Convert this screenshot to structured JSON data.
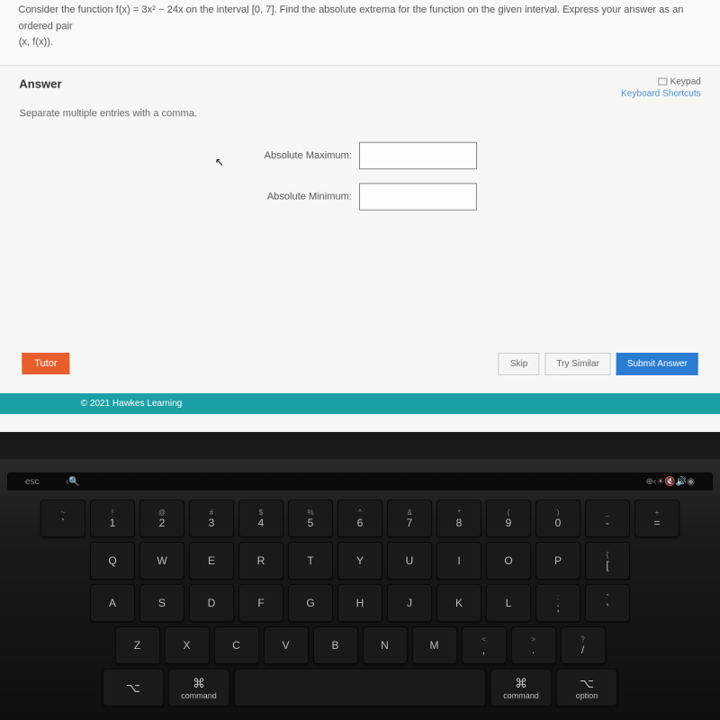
{
  "question": {
    "prompt_line1": "Consider the function f(x) = 3x² − 24x on the interval [0, 7]. Find the absolute extrema for the function on the given interval. Express your answer as an ordered pair",
    "prompt_line2": "(x, f(x))."
  },
  "answer_section": {
    "header": "Answer",
    "keypad_label": "Keypad",
    "shortcuts_label": "Keyboard Shortcuts",
    "instruction": "Separate multiple entries with a comma.",
    "max_label": "Absolute Maximum:",
    "min_label": "Absolute Minimum:",
    "max_value": "",
    "min_value": ""
  },
  "buttons": {
    "tutor": "Tutor",
    "skip": "Skip",
    "try_similar": "Try Similar",
    "submit": "Submit Answer"
  },
  "footer": {
    "copyright": "© 2021 Hawkes Learning"
  },
  "keyboard": {
    "esc": "esc",
    "touch_bar_search": "🔍",
    "row1": [
      {
        "top": "!",
        "bottom": "1"
      },
      {
        "top": "@",
        "bottom": "2"
      },
      {
        "top": "#",
        "bottom": "3"
      },
      {
        "top": "$",
        "bottom": "4"
      },
      {
        "top": "%",
        "bottom": "5"
      },
      {
        "top": "^",
        "bottom": "6"
      },
      {
        "top": "&",
        "bottom": "7"
      },
      {
        "top": "*",
        "bottom": "8"
      },
      {
        "top": "(",
        "bottom": "9"
      },
      {
        "top": ")",
        "bottom": "0"
      },
      {
        "top": "_",
        "bottom": "-"
      },
      {
        "top": "+",
        "bottom": "="
      }
    ],
    "row2": [
      "Q",
      "W",
      "E",
      "R",
      "T",
      "Y",
      "U",
      "I",
      "O",
      "P"
    ],
    "row2_extra": [
      {
        "top": "{",
        "bottom": "["
      }
    ],
    "row3": [
      "A",
      "S",
      "D",
      "F",
      "G",
      "H",
      "J",
      "K",
      "L"
    ],
    "row3_extra": [
      {
        "top": ":",
        "bottom": ";"
      },
      {
        "top": "\"",
        "bottom": "'"
      }
    ],
    "row4": [
      "Z",
      "X",
      "C",
      "V",
      "B",
      "N",
      "M"
    ],
    "row4_extra": [
      {
        "top": "<",
        "bottom": ","
      },
      {
        "top": ">",
        "bottom": "."
      },
      {
        "top": "?",
        "bottom": "/"
      }
    ],
    "option_key": "⌥",
    "option_label": "option",
    "command_symbol": "⌘",
    "command_label": "command"
  }
}
